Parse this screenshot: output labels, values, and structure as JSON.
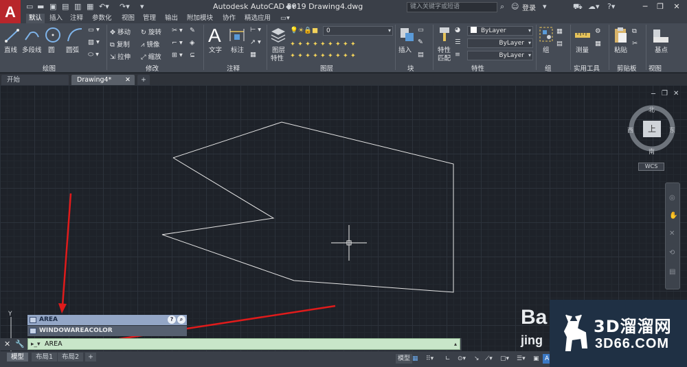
{
  "titlebar": {
    "logo": "A",
    "title": "Autodesk AutoCAD 2019    Drawing4.dwg",
    "search_placeholder": "键入关键字或短语",
    "login": "登录"
  },
  "ribbon_tabs": [
    "默认",
    "插入",
    "注释",
    "参数化",
    "视图",
    "管理",
    "输出",
    "附加模块",
    "协作",
    "精选应用"
  ],
  "ribbon": {
    "draw": {
      "line": "直线",
      "polyline": "多段线",
      "circle": "圆",
      "arc": "圆弧",
      "label": "绘图"
    },
    "modify": {
      "move": "移动",
      "rotate": "旋转",
      "copy": "复制",
      "mirror": "镜像",
      "stretch": "拉伸",
      "scale": "缩放",
      "label": "修改"
    },
    "annotation": {
      "text": "文字",
      "dimension": "标注",
      "label": "注释"
    },
    "layers": {
      "layer_properties_1": "图层",
      "layer_properties_2": "特性",
      "current_layer": "0",
      "label": "图层"
    },
    "block": {
      "insert": "插入",
      "label": "块"
    },
    "properties": {
      "match_1": "特性",
      "match_2": "匹配",
      "color": "ByLayer",
      "linetype": "ByLayer",
      "lineweight": "ByLayer",
      "label": "特性"
    },
    "groups": {
      "group": "组",
      "label": "组"
    },
    "utilities": {
      "measure": "测量",
      "label": "实用工具"
    },
    "clipboard": {
      "paste": "粘贴",
      "label": "剪贴板"
    },
    "view": {
      "base": "基点",
      "label": "视图"
    }
  },
  "file_tabs": {
    "start": "开始",
    "drawing": "Drawing4*",
    "add": "+"
  },
  "viewcube": {
    "north": "北",
    "south": "南",
    "east": "东",
    "west": "西",
    "top": "上",
    "wcs": "WCS"
  },
  "ucs": {
    "y_label": "Y"
  },
  "autocomplete": {
    "items": [
      "AREA",
      "WINDOWAREACOLOR"
    ]
  },
  "command_line": {
    "value": "AREA"
  },
  "layout_tabs": [
    "模型",
    "布局1",
    "布局2"
  ],
  "status": {
    "model": "模型"
  },
  "watermark": {
    "baidu": "Ba",
    "jing": "jing",
    "title": "3D溜溜网",
    "url": "3D66.COM"
  },
  "colors": {
    "canvas": "#1e2229",
    "ribbon": "#454b55",
    "command_input": "#c8e6c9",
    "autocomplete_selected": "#93a6c6",
    "logo": "#b8262b"
  }
}
